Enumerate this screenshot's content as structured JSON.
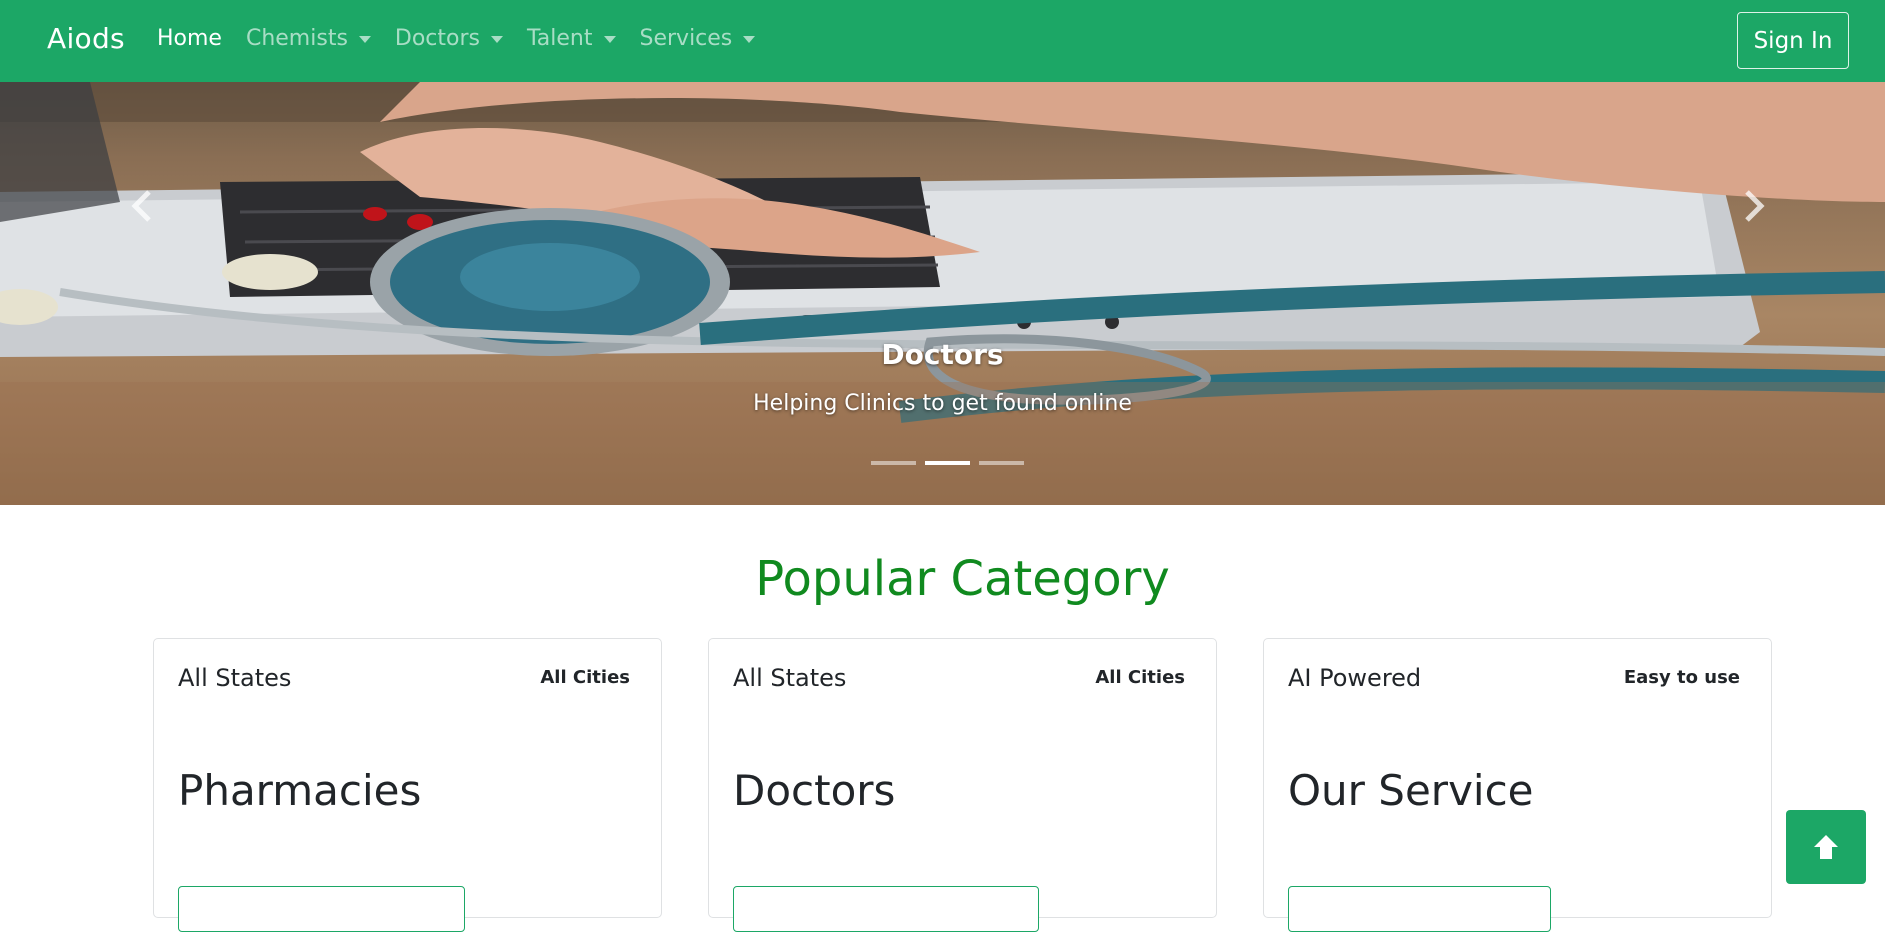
{
  "navbar": {
    "brand": "Aiods",
    "items": [
      {
        "label": "Home",
        "dropdown": false,
        "active": true
      },
      {
        "label": "Chemists",
        "dropdown": true,
        "active": false
      },
      {
        "label": "Doctors",
        "dropdown": true,
        "active": false
      },
      {
        "label": "Talent",
        "dropdown": true,
        "active": false
      },
      {
        "label": "Services",
        "dropdown": true,
        "active": false
      }
    ],
    "signin_label": "Sign In",
    "background": "#1ca766"
  },
  "carousel": {
    "caption_title": "Doctors",
    "caption_text": "Helping Clinics to get found online",
    "slide_count": 3,
    "active_slide": 2,
    "prev_icon": "chevron-left-icon",
    "next_icon": "chevron-right-icon"
  },
  "section": {
    "title": "Popular Category",
    "title_color": "#108a1f"
  },
  "cards": [
    {
      "top_left": "All States",
      "top_right": "All Cities",
      "title": "Pharmacies"
    },
    {
      "top_left": "All States",
      "top_right": "All Cities",
      "title": "Doctors"
    },
    {
      "top_left": "AI Powered",
      "top_right": "Easy to use",
      "title": "Our Service"
    }
  ],
  "back_to_top": {
    "icon": "arrow-up-icon"
  }
}
